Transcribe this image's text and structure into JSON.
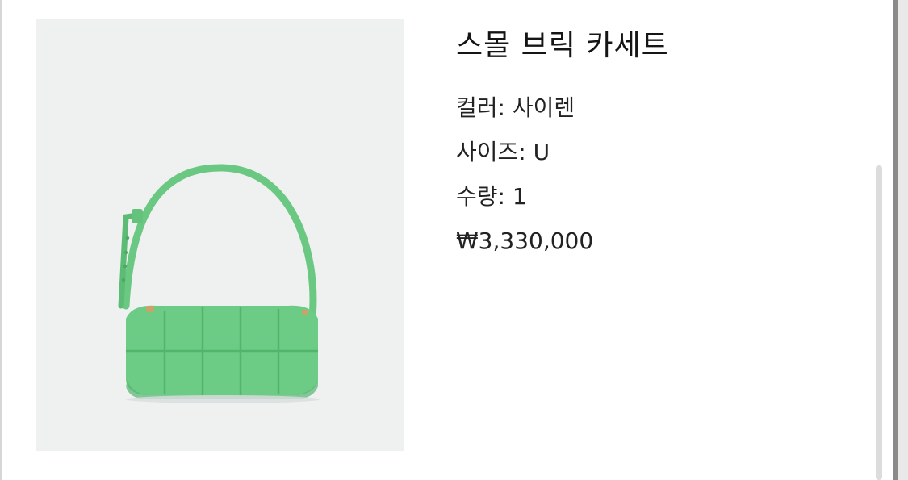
{
  "product": {
    "title": "스몰 브릭 카세트",
    "color_line": "컬러: 사이렌",
    "size_line": "사이즈: U",
    "quantity_line": "수량: 1",
    "price": "₩3,330,000",
    "image_alt": "green woven shoulder bag",
    "bag_color": "#6ccb84"
  }
}
